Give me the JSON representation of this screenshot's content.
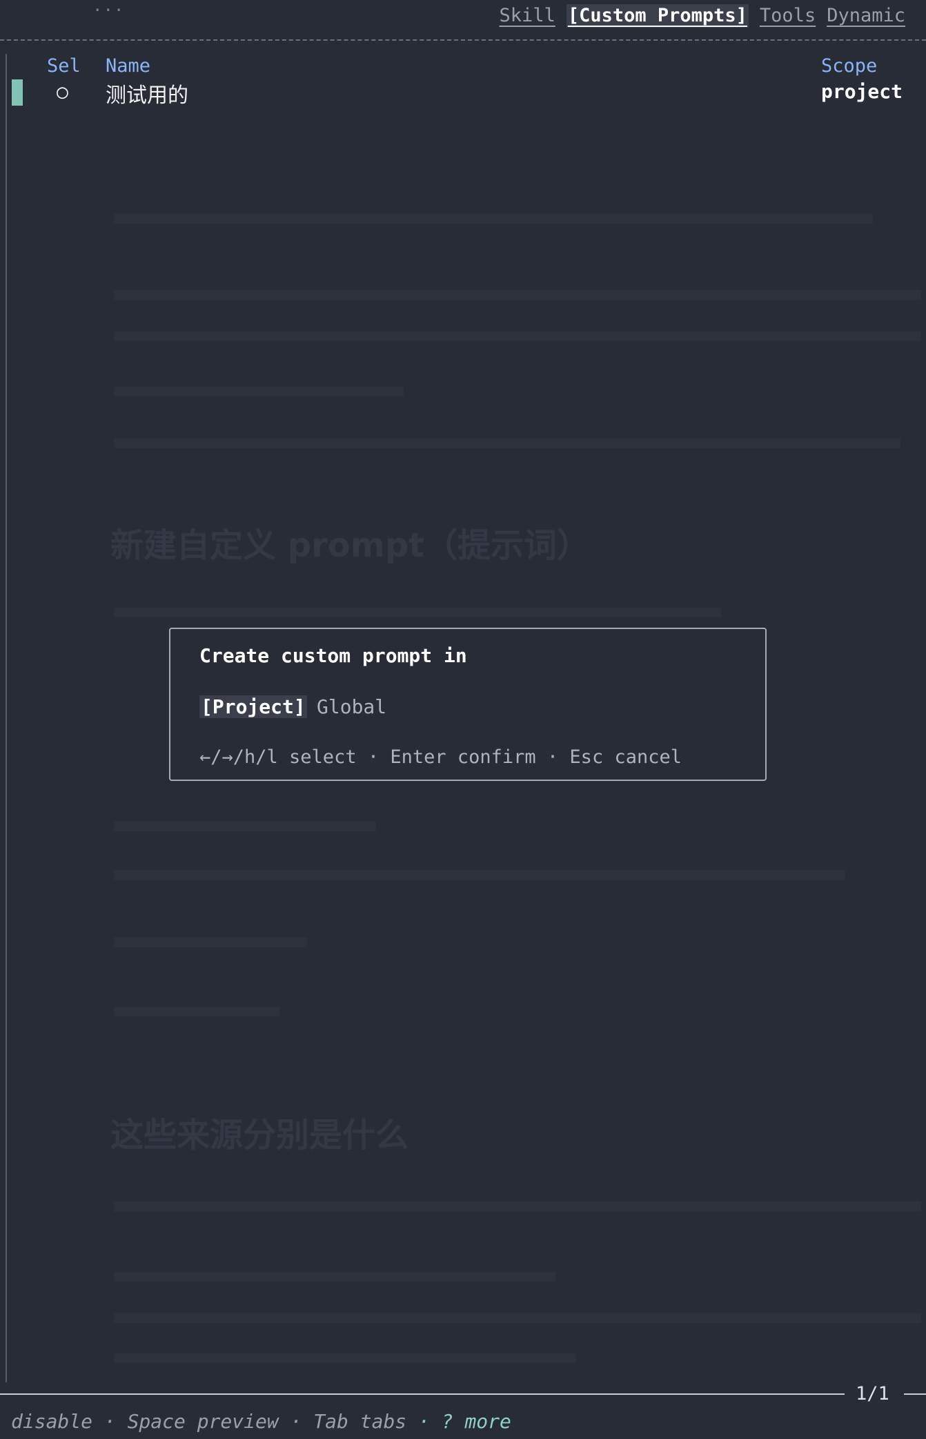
{
  "tabs": [
    {
      "label": "Skill",
      "active": false
    },
    {
      "label": "[Custom Prompts]",
      "active": true
    },
    {
      "label": "Tools",
      "active": false
    },
    {
      "label": "Dynamic",
      "active": false
    }
  ],
  "ellipsis": "...",
  "table": {
    "headers": {
      "sel": "Sel",
      "name": "Name",
      "scope": "Scope"
    },
    "rows": [
      {
        "sel": "○",
        "name": "测试用的",
        "scope": "project"
      }
    ]
  },
  "background_text": {
    "heading1": "新建自定义 prompt（提示词）",
    "heading2": "这些来源分别是什么"
  },
  "modal": {
    "title": "Create custom prompt in",
    "option_selected": "[Project]",
    "option_other": "Global",
    "hint": "←/→/h/l select · Enter confirm · Esc cancel"
  },
  "footer": {
    "page": "1/1",
    "hints": [
      {
        "text": "disable · Space preview · Tab tabs ",
        "emphasis": false
      },
      {
        "text": "· ? more",
        "emphasis": true
      }
    ]
  },
  "colors": {
    "background": "#282c36",
    "header_blue": "#8ab4f8",
    "selection_bar": "#82c4b4",
    "hint_accent": "#8fd0c4"
  }
}
